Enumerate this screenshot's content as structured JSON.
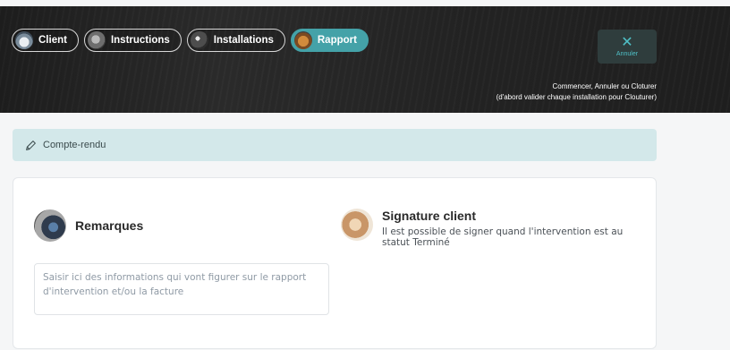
{
  "tabs": [
    {
      "label": "Client",
      "icon": "client-photo",
      "active": false
    },
    {
      "label": "Instructions",
      "icon": "instructions-photo",
      "active": false
    },
    {
      "label": "Installations",
      "icon": "installations-photo",
      "active": false
    },
    {
      "label": "Rapport",
      "icon": "rapport-photo",
      "active": true
    }
  ],
  "cancel": {
    "icon": "close-icon",
    "label": "Annuler"
  },
  "hint": {
    "line1": "Commencer, Annuler ou Cloturer",
    "line2": "(d'abord valider chaque installation pour Clouturer)"
  },
  "report": {
    "icon": "pencil-icon",
    "label": "Compte-rendu"
  },
  "remarks": {
    "title": "Remarques",
    "placeholder": "Saisir ici des informations qui vont figurer sur le rapport d'intervention et/ou la facture"
  },
  "signature": {
    "title": "Signature client",
    "description": "Il est possible de signer quand l'intervention est au statut Terminé"
  },
  "colors": {
    "accent": "#44a2a8",
    "report_bg": "#d3e8ea",
    "header_bg": "#222222"
  }
}
